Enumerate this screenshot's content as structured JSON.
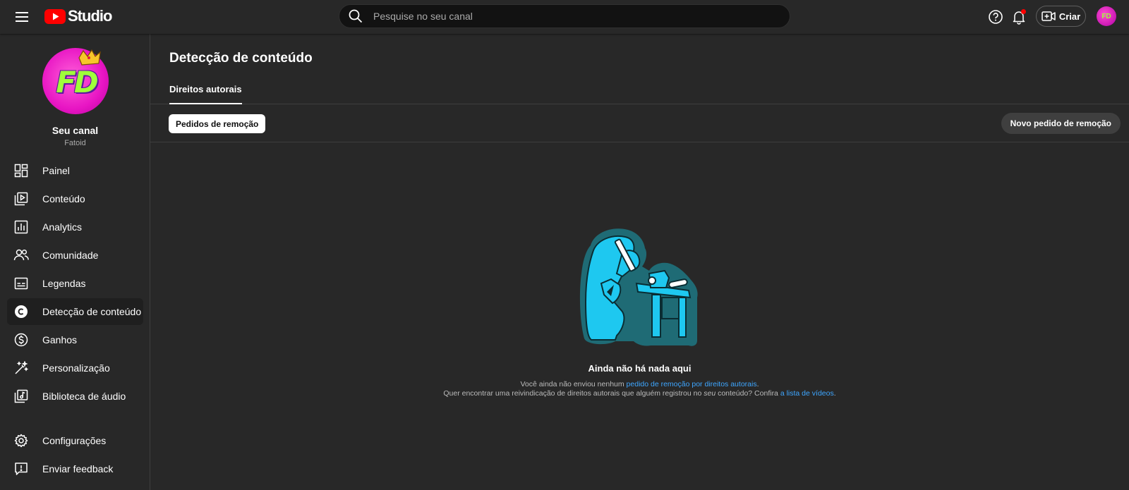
{
  "header": {
    "logo_text": "Studio",
    "search_placeholder": "Pesquise no seu canal",
    "create_label": "Criar",
    "avatar_initials": "FD"
  },
  "sidebar": {
    "channel_initials": "FD",
    "channel_title": "Seu canal",
    "channel_handle": "Fatoid",
    "items": [
      {
        "label": "Painel"
      },
      {
        "label": "Conteúdo"
      },
      {
        "label": "Analytics"
      },
      {
        "label": "Comunidade"
      },
      {
        "label": "Legendas"
      },
      {
        "label": "Detecção de conteúdo"
      },
      {
        "label": "Ganhos"
      },
      {
        "label": "Personalização"
      },
      {
        "label": "Biblioteca de áudio"
      },
      {
        "label": "Configurações"
      },
      {
        "label": "Enviar feedback"
      }
    ]
  },
  "main": {
    "title": "Detecção de conteúdo",
    "tab_label": "Direitos autorais",
    "chip_label": "Pedidos de remoção",
    "new_request_label": "Novo pedido de remoção",
    "empty": {
      "title": "Ainda não há nada aqui",
      "line1_prefix": "Você ainda não enviou nenhum ",
      "line1_link": "pedido de remoção por direitos autorais",
      "line1_suffix": ".",
      "line2_prefix": "Quer encontrar uma reivindicação de direitos autorais que alguém registrou no ",
      "line2_emph": "seu",
      "line2_middle": " conteúdo? Confira ",
      "line2_link": "a lista de vídeos",
      "line2_suffix": "."
    }
  },
  "colors": {
    "background": "#282828",
    "link": "#3ea6ff",
    "brand_red": "#ff0000",
    "illustration_cyan": "#1ec8f0",
    "illustration_teal": "#1f6b75"
  }
}
